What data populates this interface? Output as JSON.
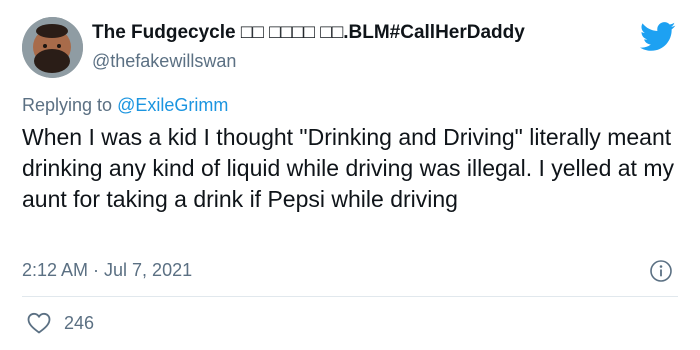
{
  "tweet": {
    "display_name": "The Fudgecycle □□ □□□□ □□.BLM#CallHerDaddy",
    "handle": "@thefakewillswan",
    "replying_to_prefix": "Replying to ",
    "replying_to_handle": "@ExileGrimm",
    "text": "When I was a kid I thought \"Drinking and Driving\" literally meant drinking any kind of liquid while driving was illegal. I yelled at my aunt for taking a drink if Pepsi while driving",
    "timestamp": "2:12 AM · Jul 7, 2021",
    "like_count": "246"
  },
  "icons": {
    "brand": "twitter-bird-icon",
    "info": "info-icon",
    "like": "heart-icon"
  },
  "colors": {
    "brand_blue": "#1da1f2",
    "mention_blue": "#1b95e0",
    "secondary_text": "#5b7083",
    "primary_text": "#0f1419",
    "divider": "#e1e8ed"
  }
}
